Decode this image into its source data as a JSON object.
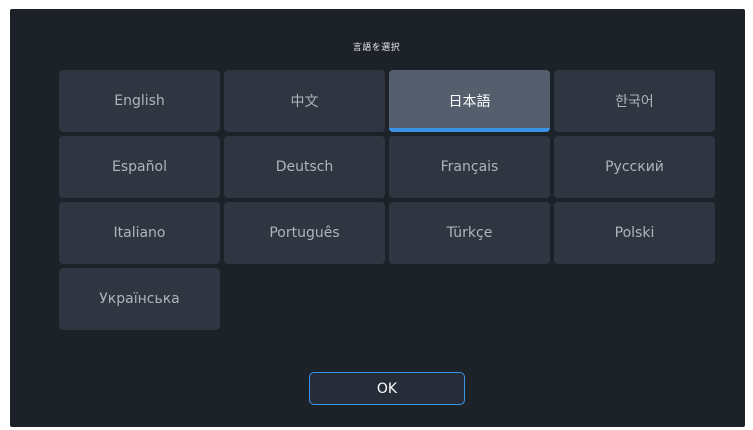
{
  "dialog": {
    "title": "言語を選択",
    "ok_label": "OK"
  },
  "languages": [
    {
      "label": "English"
    },
    {
      "label": "中文"
    },
    {
      "label": "日本語",
      "selected": true
    },
    {
      "label": "한국어"
    },
    {
      "label": "Español"
    },
    {
      "label": "Deutsch"
    },
    {
      "label": "Français"
    },
    {
      "label": "Русский"
    },
    {
      "label": "Italiano"
    },
    {
      "label": "Português"
    },
    {
      "label": "Türkçe"
    },
    {
      "label": "Polski"
    },
    {
      "label": "Українська"
    }
  ],
  "colors": {
    "background": "#1d2128",
    "tile": "#2f3642",
    "tile_selected": "#545e6d",
    "accent": "#3a93e6"
  }
}
